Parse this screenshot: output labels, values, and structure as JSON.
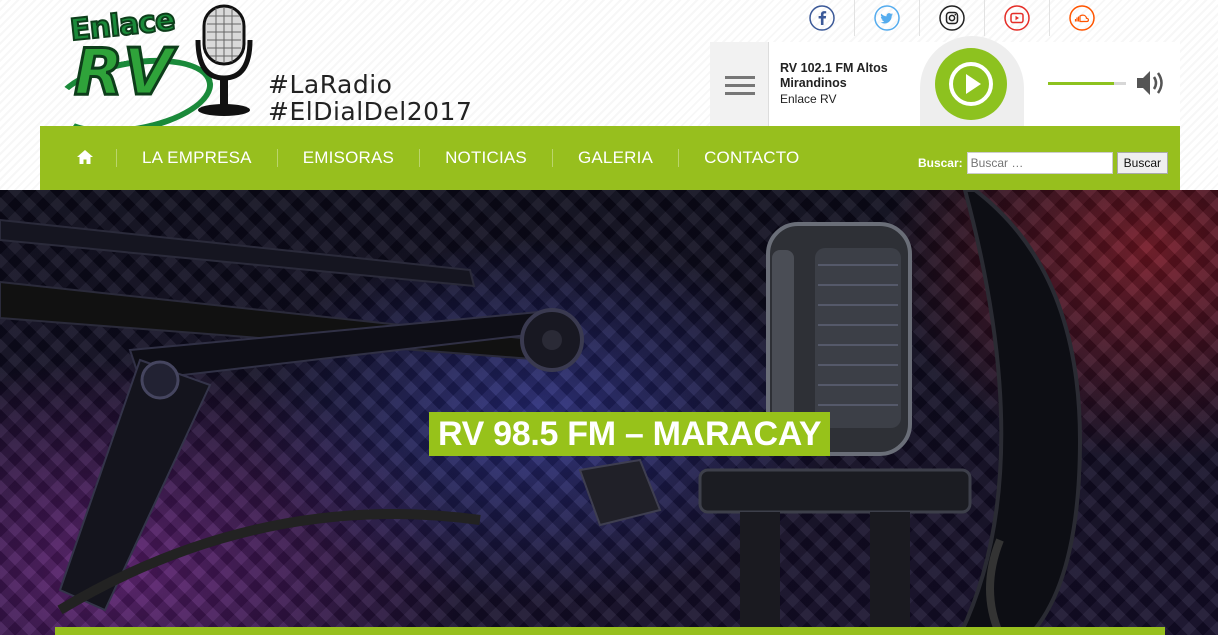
{
  "logo": {
    "word_top": "Enlace",
    "word_main": "RV",
    "tagline_1": "#LaRadio",
    "tagline_2": "#ElDialDel2017"
  },
  "social": [
    {
      "name": "facebook-icon",
      "glyph": "f",
      "color": "#3b5998"
    },
    {
      "name": "twitter-icon",
      "color": "#55acee"
    },
    {
      "name": "instagram-icon",
      "color": "#222222"
    },
    {
      "name": "youtube-icon",
      "color": "#e52d27"
    },
    {
      "name": "soundcloud-icon",
      "color": "#ff5500"
    }
  ],
  "player": {
    "station": "RV 102.1 FM Altos Mirandinos",
    "artist": "Enlace RV",
    "volume": 0.85,
    "accent": "#8dc21f"
  },
  "nav": {
    "items": [
      "LA EMPRESA",
      "EMISORAS",
      "NOTICIAS",
      "GALERIA",
      "CONTACTO"
    ],
    "home_icon": "home-icon"
  },
  "search": {
    "label": "Buscar:",
    "placeholder": "Buscar …",
    "button": "Buscar"
  },
  "hero": {
    "title": "RV 98.5 FM – MARACAY"
  }
}
